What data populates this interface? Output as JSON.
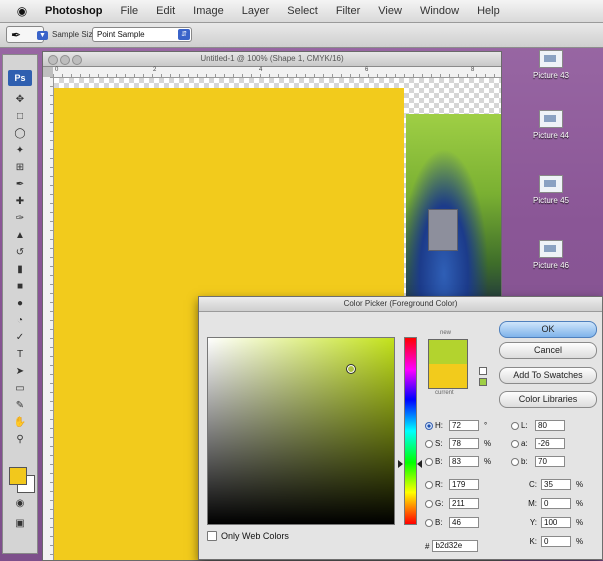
{
  "menubar": {
    "app": "Photoshop",
    "items": [
      "File",
      "Edit",
      "Image",
      "Layer",
      "Select",
      "Filter",
      "View",
      "Window",
      "Help"
    ]
  },
  "options_bar": {
    "tool_icon": "eyedropper-icon",
    "sample_size_label": "Sample Size:",
    "sample_size_value": "Point Sample"
  },
  "tool_panel": {
    "logo": "Ps",
    "foreground_color": "#f2cb1c",
    "background_color": "#ffffff"
  },
  "document": {
    "title": "Untitled-1 @ 100% (Shape 1, CMYK/16)",
    "ruler_numbers": [
      "0",
      "2",
      "4",
      "6",
      "8"
    ]
  },
  "desktop_icons": [
    {
      "label": "Picture 43"
    },
    {
      "label": "Picture 44"
    },
    {
      "label": "Picture 45"
    },
    {
      "label": "Picture 46"
    }
  ],
  "color_picker": {
    "title": "Color Picker (Foreground Color)",
    "new_label": "new",
    "current_label": "current",
    "new_color": "#b3d32e",
    "current_color": "#f2cb1c",
    "buttons": {
      "ok": "OK",
      "cancel": "Cancel",
      "add_to_swatches": "Add To Swatches",
      "color_libraries": "Color Libraries"
    },
    "only_web_colors": "Only Web Colors",
    "hsb": [
      {
        "label": "H:",
        "value": "72",
        "unit": "°",
        "selected": true
      },
      {
        "label": "S:",
        "value": "78",
        "unit": "%",
        "selected": false
      },
      {
        "label": "B:",
        "value": "83",
        "unit": "%",
        "selected": false
      }
    ],
    "rgb": [
      {
        "label": "R:",
        "value": "179",
        "selected": false
      },
      {
        "label": "G:",
        "value": "211",
        "selected": false
      },
      {
        "label": "B:",
        "value": "46",
        "selected": false
      }
    ],
    "lab": [
      {
        "label": "L:",
        "value": "80",
        "selected": false
      },
      {
        "label": "a:",
        "value": "-26",
        "selected": false
      },
      {
        "label": "b:",
        "value": "70",
        "selected": false
      }
    ],
    "cmyk": [
      {
        "label": "C:",
        "value": "35",
        "unit": "%"
      },
      {
        "label": "M:",
        "value": "0",
        "unit": "%"
      },
      {
        "label": "Y:",
        "value": "100",
        "unit": "%"
      },
      {
        "label": "K:",
        "value": "0",
        "unit": "%"
      }
    ],
    "hex_label": "#",
    "hex_value": "b2d32e"
  }
}
